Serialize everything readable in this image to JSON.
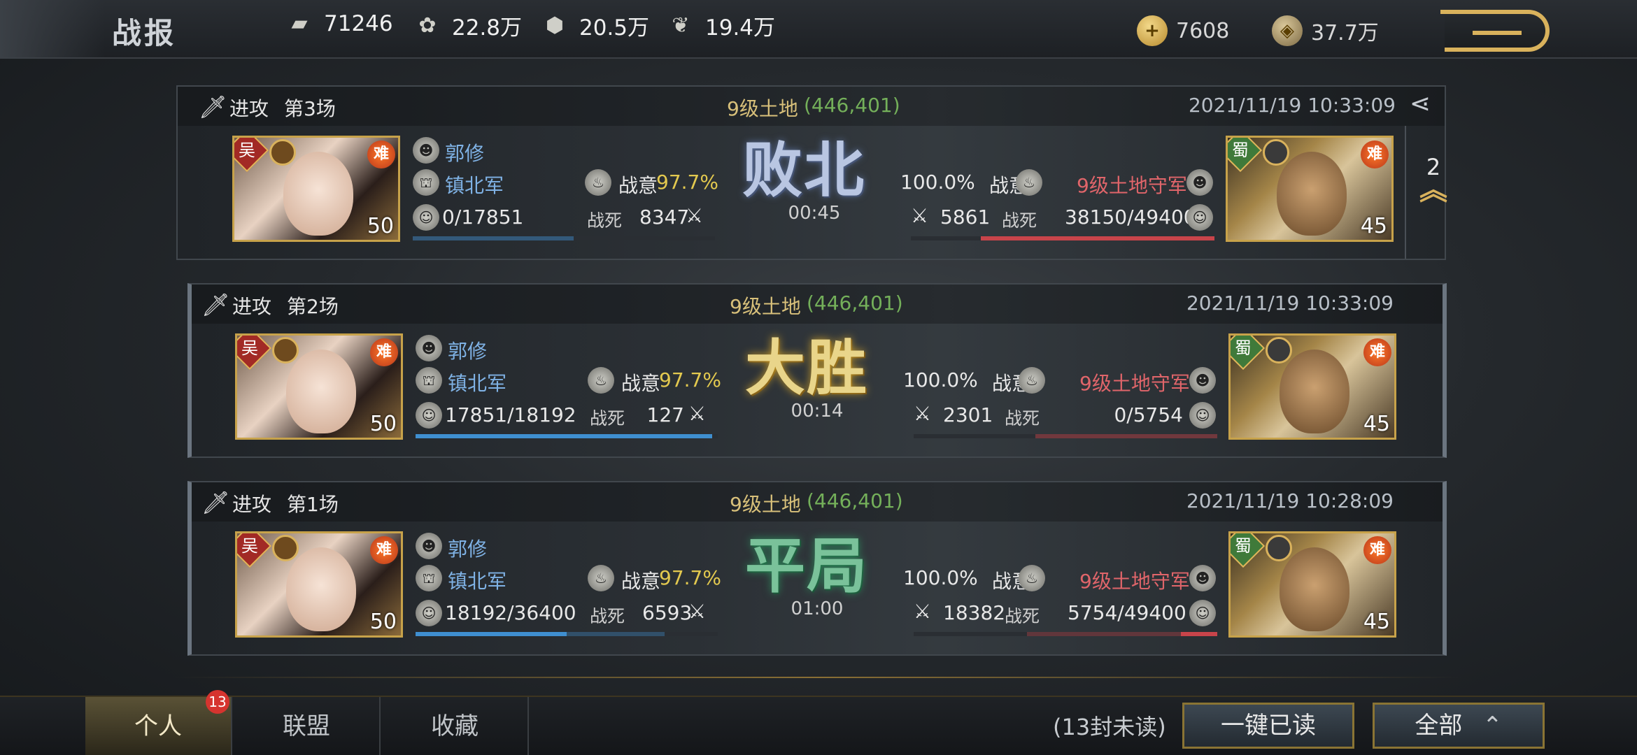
{
  "header": {
    "title": "战报",
    "resources": [
      {
        "icon": "stone-icon",
        "value": "71246"
      },
      {
        "icon": "grain-icon",
        "value": "22.8万"
      },
      {
        "icon": "iron-icon",
        "value": "20.5万"
      },
      {
        "icon": "wood-icon",
        "value": "19.4万"
      }
    ],
    "currencies": [
      {
        "icon": "gold-coin-icon",
        "value": "7608"
      },
      {
        "icon": "copper-coin-icon",
        "value": "37.7万"
      }
    ]
  },
  "reports": [
    {
      "type": "进攻",
      "round": "第3场",
      "land": "9级土地",
      "coord": "(446,401)",
      "time": "2021/11/19 10:33:09",
      "result": "败北",
      "result_class": "res-lose",
      "duration": "00:45",
      "left": {
        "faction": "吴",
        "name": "郭修",
        "army": "镇北军",
        "morale_label": "战意",
        "morale": "97.7%",
        "troops": "0/17851",
        "dead_label": "战死",
        "dead": "8347",
        "level": "50",
        "tag": "难",
        "bar": 0.0
      },
      "right": {
        "faction": "蜀",
        "name": "9级土地守军",
        "morale": "100.0%",
        "morale_label": "战意",
        "troops": "38150/49400",
        "dead_label": "战死",
        "dead": "5861",
        "level": "45",
        "tag": "难",
        "bar": 0.77
      },
      "side_count": "2"
    },
    {
      "type": "进攻",
      "round": "第2场",
      "land": "9级土地",
      "coord": "(446,401)",
      "time": "2021/11/19 10:33:09",
      "result": "大胜",
      "result_class": "res-win",
      "duration": "00:14",
      "left": {
        "faction": "吴",
        "name": "郭修",
        "army": "镇北军",
        "morale_label": "战意",
        "morale": "97.7%",
        "troops": "17851/18192",
        "dead_label": "战死",
        "dead": "127",
        "level": "50",
        "tag": "难",
        "bar": 0.98
      },
      "right": {
        "faction": "蜀",
        "name": "9级土地守军",
        "morale": "100.0%",
        "morale_label": "战意",
        "troops": "0/5754",
        "dead_label": "战死",
        "dead": "2301",
        "level": "45",
        "tag": "难",
        "bar": 0.0
      }
    },
    {
      "type": "进攻",
      "round": "第1场",
      "land": "9级土地",
      "coord": "(446,401)",
      "time": "2021/11/19 10:28:09",
      "result": "平局",
      "result_class": "res-draw",
      "duration": "01:00",
      "left": {
        "faction": "吴",
        "name": "郭修",
        "army": "镇北军",
        "morale_label": "战意",
        "morale": "97.7%",
        "troops": "18192/36400",
        "dead_label": "战死",
        "dead": "6593",
        "level": "50",
        "tag": "难",
        "bar": 0.5
      },
      "right": {
        "faction": "蜀",
        "name": "9级土地守军",
        "morale": "100.0%",
        "morale_label": "战意",
        "troops": "5754/49400",
        "dead_label": "战死",
        "dead": "18382",
        "level": "45",
        "tag": "难",
        "bar": 0.12
      }
    }
  ],
  "footer": {
    "tabs": [
      {
        "label": "个人",
        "badge": "13"
      },
      {
        "label": "联盟"
      },
      {
        "label": "收藏"
      }
    ],
    "unread": "(13封未读)",
    "read_all": "一键已读",
    "filter": "全部"
  }
}
